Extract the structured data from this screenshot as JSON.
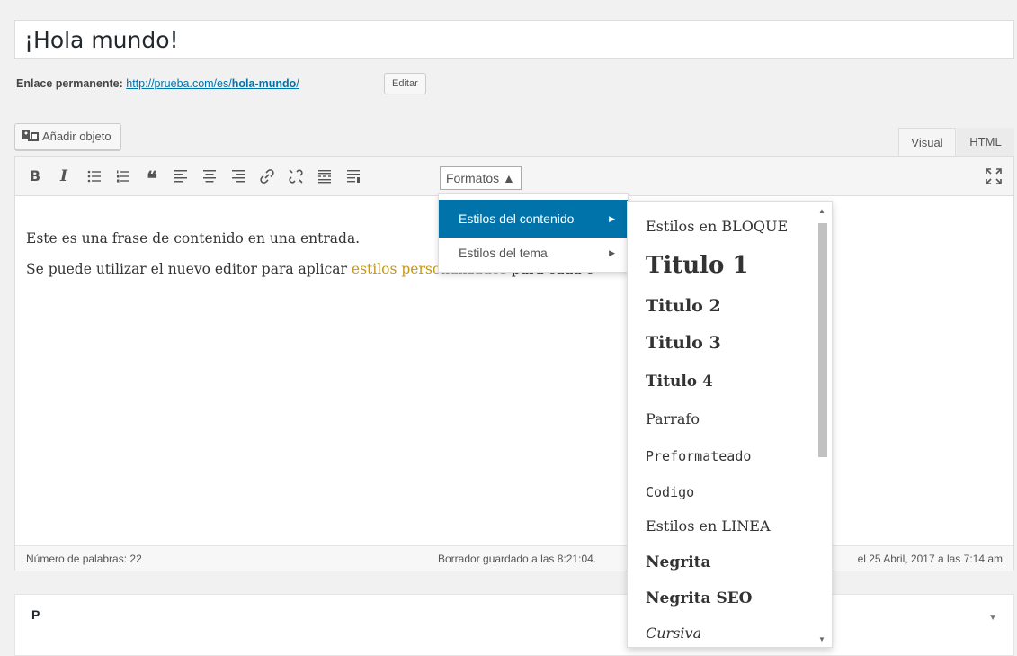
{
  "title": "¡Hola mundo!",
  "permalink": {
    "label": "Enlace permanente:",
    "url_prefix": "http://prueba.com/es/",
    "slug": "hola-mundo",
    "url_suffix": "/",
    "edit_label": "Editar"
  },
  "media_button": "Añadir objeto",
  "tabs": {
    "visual": "Visual",
    "html": "HTML"
  },
  "toolbar": {
    "bold": "B",
    "italic": "I",
    "formats_label": "Formatos ▲"
  },
  "content": {
    "p1": "Este es una frase de contenido en una entrada.",
    "p2_start": "Se puede utilizar el nuevo editor para aplicar ",
    "p2_styled": "estilos personalizados",
    "p2_end": " para cada c",
    "styled_color": "#c79615"
  },
  "status": {
    "word_count": "Número de palabras: 22",
    "saved": "Borrador guardado a las 8:21:04.",
    "edited": "el 25 Abril, 2017 a las 7:14 am"
  },
  "postbox_title": "P      ",
  "formats_menu": {
    "items": [
      {
        "label": "Estilos del contenido",
        "active": true
      },
      {
        "label": "Estilos del tema",
        "active": false
      }
    ]
  },
  "styles_submenu": {
    "items": [
      "Estilos en BLOQUE",
      "Titulo 1",
      "Titulo 2",
      "Titulo 3",
      "Titulo 4",
      "Parrafo",
      "Preformateado",
      "Codigo",
      "Estilos en LINEA",
      "Negrita",
      "Negrita SEO",
      "Cursiva"
    ]
  },
  "colors": {
    "accent": "#0073aa",
    "link": "#0073aa"
  }
}
